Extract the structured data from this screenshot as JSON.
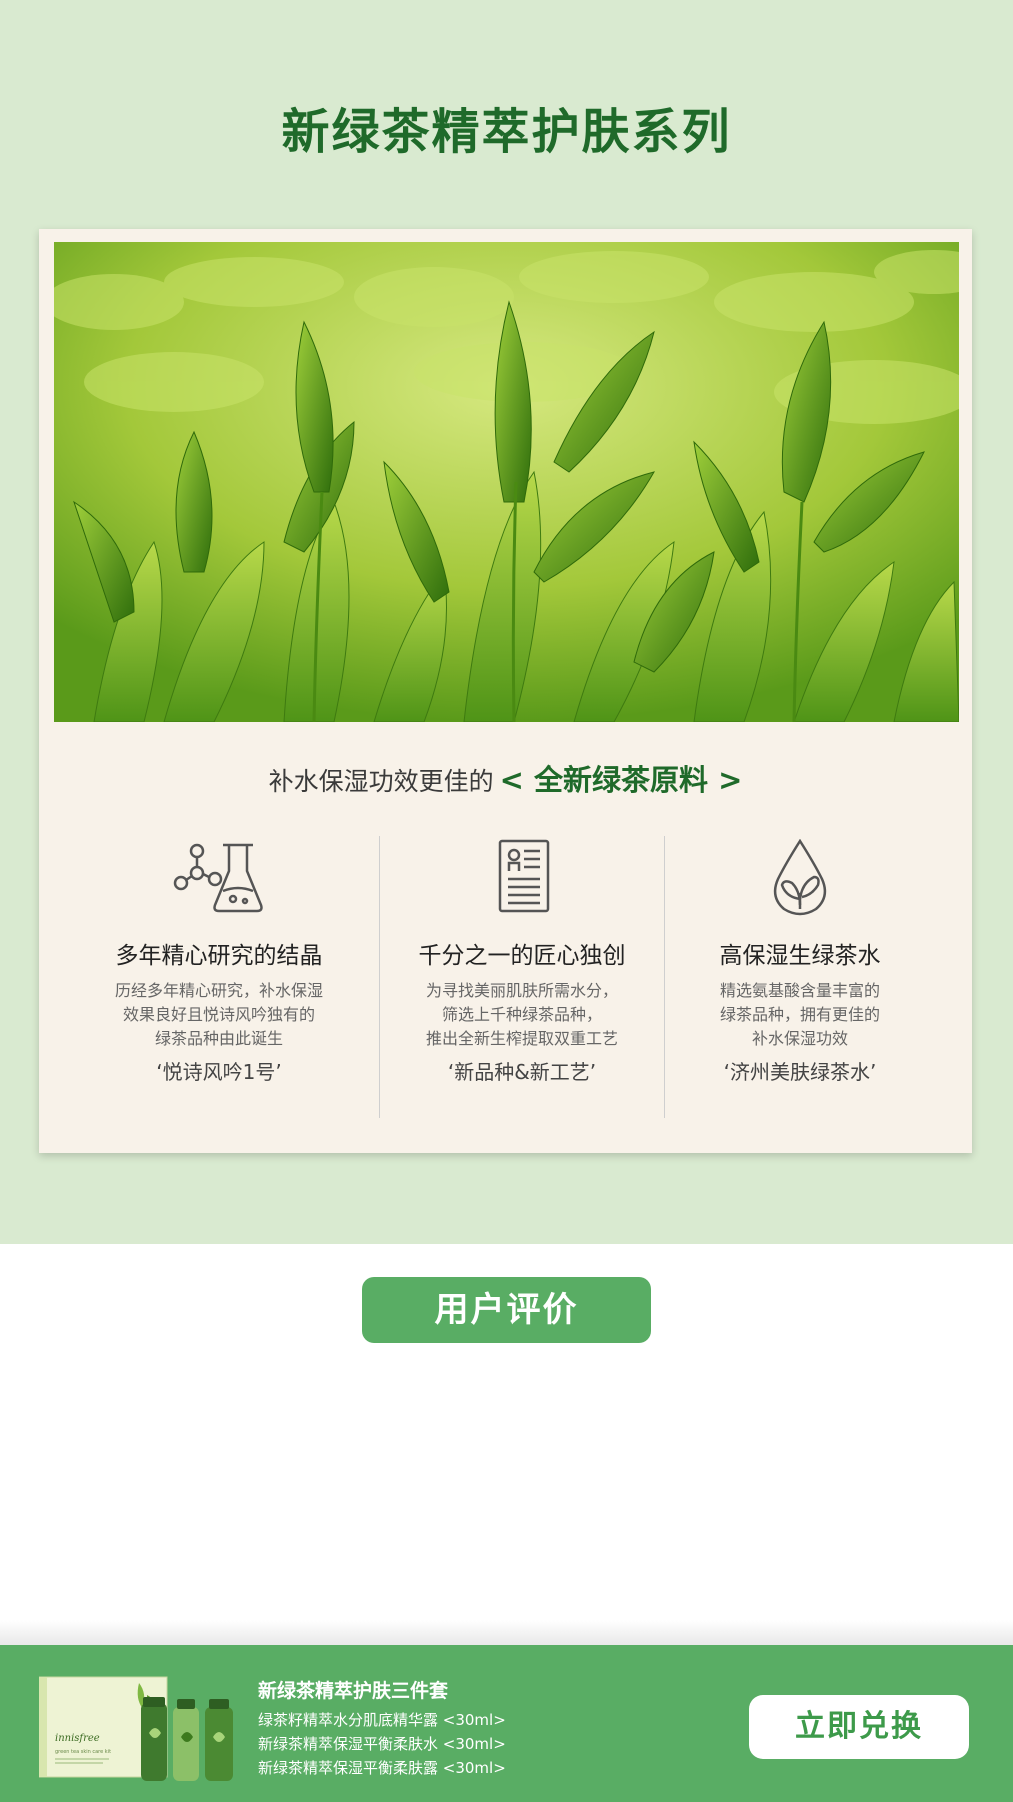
{
  "series": {
    "title": "新绿茶精萃护肤系列"
  },
  "tagline": {
    "plain": "补水保湿功效更佳的",
    "highlight": "< 全新绿茶原料 >"
  },
  "features": [
    {
      "icon": "lab-flask-icon",
      "title": "多年精心研究的结晶",
      "desc": [
        "历经多年精心研究，补水保湿",
        "效果良好且悦诗风吟独有的",
        "绿茶品种由此诞生"
      ],
      "quote": "‘悦诗风吟1号’"
    },
    {
      "icon": "document-icon",
      "title": "千分之一的匠心独创",
      "desc": [
        "为寻找美丽肌肤所需水分，",
        "筛选上千种绿茶品种，",
        "推出全新生榨提取双重工艺"
      ],
      "quote": "‘新品种&新工艺’"
    },
    {
      "icon": "water-drop-leaf-icon",
      "title": "高保湿生绿茶水",
      "desc": [
        "精选氨基酸含量丰富的",
        "绿茶品种，拥有更佳的",
        "补水保湿功效"
      ],
      "quote": "‘济州美肤绿茶水’"
    }
  ],
  "reviews": {
    "button_label": "用户评价"
  },
  "product": {
    "name": "新绿茶精萃护肤三件套",
    "items": [
      "绿茶籽精萃水分肌底精华露 <30ml>",
      "新绿茶精萃保湿平衡柔肤水 <30ml>",
      "新绿茶精萃保湿平衡柔肤露 <30ml>"
    ],
    "box_brand": "innisfree",
    "box_subtitle": "green tea skin care kit",
    "redeem_label": "立即兑换"
  },
  "colors": {
    "page_bg": "#d9ead0",
    "card_bg": "#f8f2e9",
    "accent_green": "#59ad64",
    "title_green": "#1f6a2a"
  }
}
